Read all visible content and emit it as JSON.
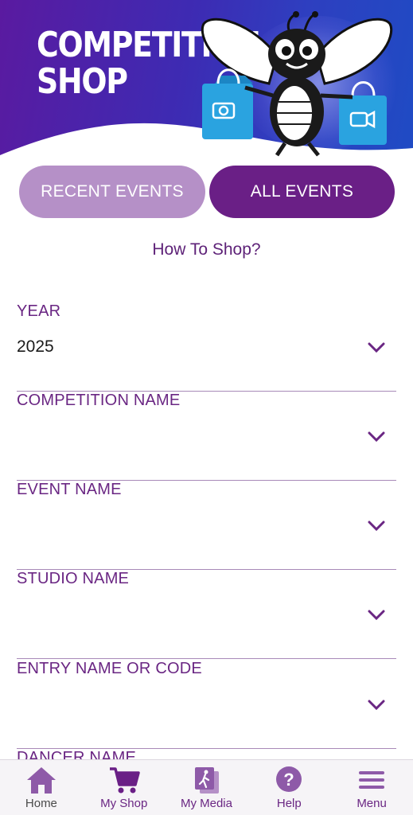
{
  "banner": {
    "title_line1": "COMPETITION",
    "title_line2": "SHOP"
  },
  "tabs": [
    {
      "label": "RECENT EVENTS",
      "active": false
    },
    {
      "label": "ALL EVENTS",
      "active": true
    }
  ],
  "how_to_shop": "How To Shop?",
  "fields": [
    {
      "label": "YEAR",
      "value": "2025"
    },
    {
      "label": "COMPETITION NAME",
      "value": ""
    },
    {
      "label": "EVENT NAME",
      "value": ""
    },
    {
      "label": "STUDIO NAME",
      "value": ""
    },
    {
      "label": "ENTRY NAME OR CODE",
      "value": ""
    },
    {
      "label": "DANCER NAME",
      "value": ""
    }
  ],
  "bottom_nav": [
    {
      "label": "Home",
      "icon": "home-icon"
    },
    {
      "label": "My Shop",
      "icon": "cart-icon"
    },
    {
      "label": "My Media",
      "icon": "media-icon"
    },
    {
      "label": "Help",
      "icon": "help-icon"
    },
    {
      "label": "Menu",
      "icon": "menu-icon"
    }
  ],
  "colors": {
    "primary_purple": "#6a1f86",
    "light_purple": "#b590c7",
    "label_purple": "#6a2683",
    "bag_blue": "#2aa3e0"
  }
}
